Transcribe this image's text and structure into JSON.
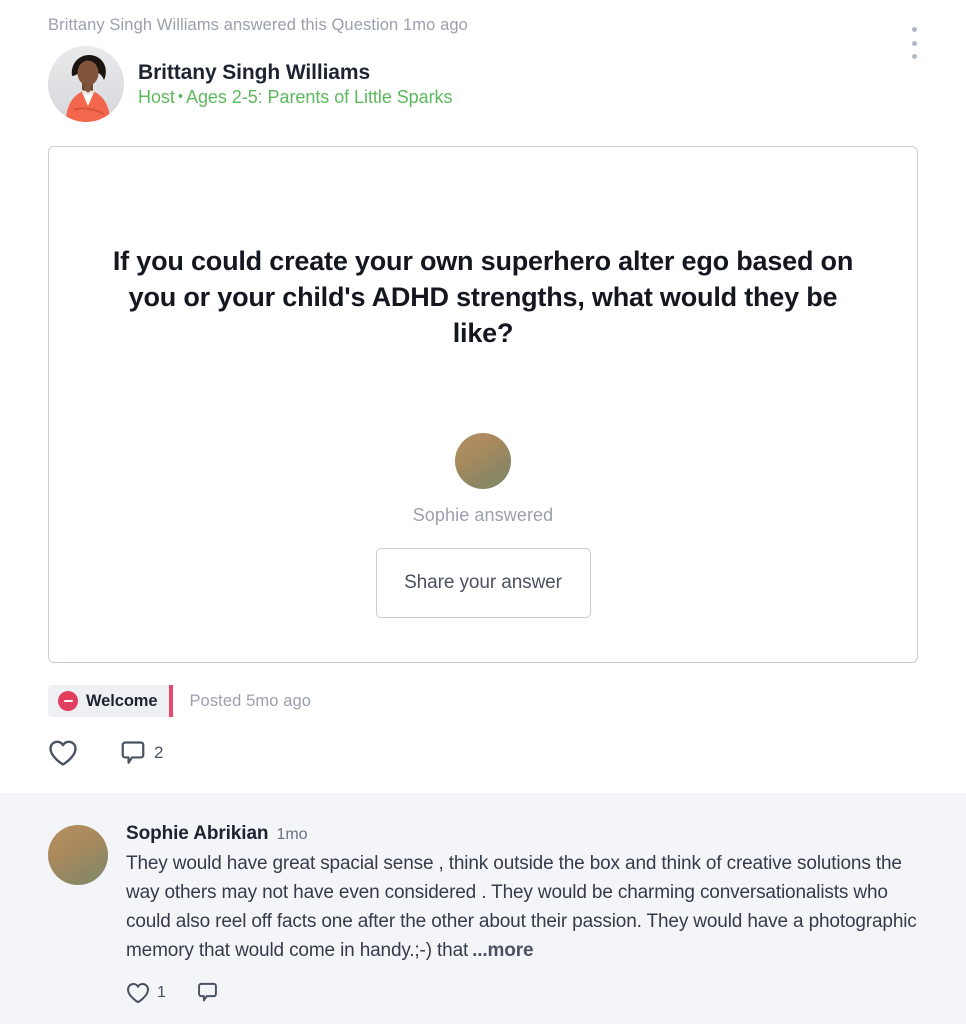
{
  "accent": {
    "pink": "#E8476F",
    "badge_red": "#E23E5E",
    "green": "#5CB85C",
    "muted": "#9AA0AD",
    "text": "#1D2330",
    "comment_bg": "#F3F5F8"
  },
  "post": {
    "meta_line": "Brittany Singh Williams answered this Question 1mo ago",
    "author": {
      "name": "Brittany Singh Williams",
      "role": "Host",
      "separator": "•",
      "group": "Ages 2-5: Parents of Little Sparks"
    },
    "question": "If you could create your own superhero alter ego based on you or your child's ADHD strengths, what would they be like?",
    "answered_label": "Sophie answered",
    "share_button": "Share your answer",
    "tag": "Welcome",
    "posted": "Posted 5mo ago",
    "reactions": {
      "like_count": "",
      "comment_count": "2"
    }
  },
  "comments": [
    {
      "author": "Sophie Abrikian",
      "time": "1mo",
      "text": "They would have great spacial sense , think outside the box and think of creative solutions the way others may not have even considered . They would be charming conversationalists who could also reel off facts one after the other about their passion. They would have a photographic memory that would come in handy.;-) that",
      "more_label": "...more",
      "like_count": "1",
      "reply_count": ""
    }
  ],
  "icons": {
    "overflow": "more-vertical-icon",
    "heart": "heart-icon",
    "comment": "comment-bubble-icon"
  }
}
